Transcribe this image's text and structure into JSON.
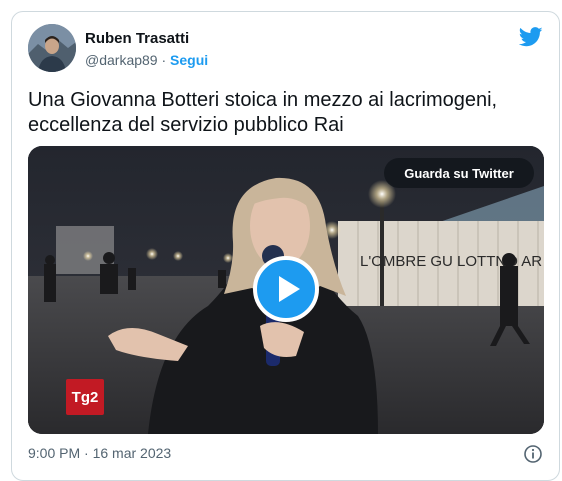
{
  "author": {
    "name": "Ruben Trasatti",
    "handle": "@darkap89",
    "separator": "·",
    "follow_label": "Segui"
  },
  "tweet": {
    "text_line1": "Una Giovanna Botteri stoica in mezzo ai lacrimogeni,",
    "text_line2": "eccellenza del servizio pubblico Rai"
  },
  "video": {
    "watch_label": "Guarda su Twitter",
    "channel_logo_text": "Tg2",
    "fence_graffiti": "L'OMBRE GU LOTTNO AR"
  },
  "footer": {
    "timestamp": "9:00 PM · 16 mar 2023"
  },
  "colors": {
    "brand_blue": "#1d9bf0",
    "text_primary": "#0f1419",
    "text_secondary": "#536471",
    "tg2_red": "#c21a24"
  },
  "icons": [
    "twitter-bird-icon",
    "play-icon",
    "info-icon"
  ]
}
